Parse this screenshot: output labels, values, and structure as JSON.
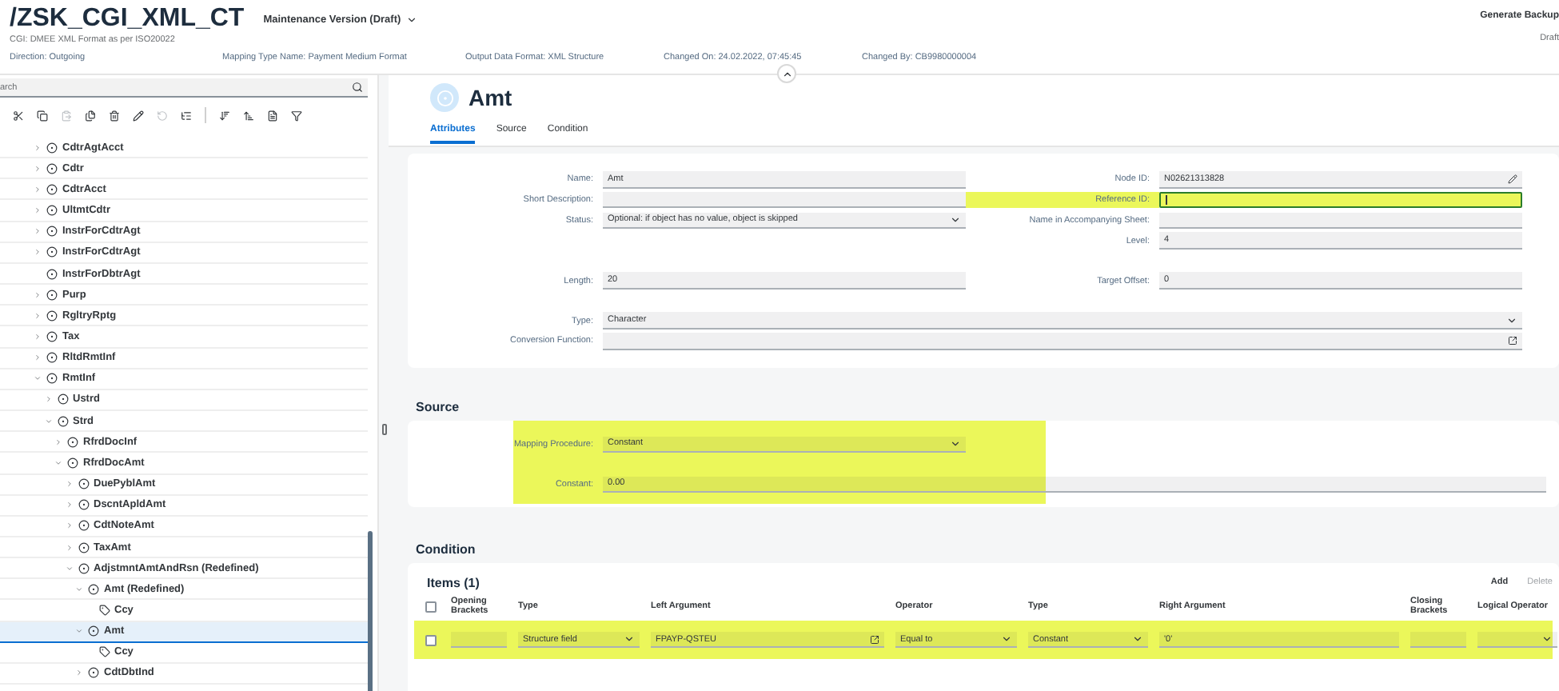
{
  "header": {
    "title": "/ZSK_CGI_XML_CT",
    "version": "Maintenance Version (Draft)",
    "subtitle": "CGI: DMEE XML Format as per ISO20022",
    "info": [
      "Direction: Outgoing",
      "Mapping Type Name: Payment Medium Format",
      "Output Data Format: XML Structure",
      "Changed On: 24.02.2022, 07:45:45",
      "Changed By: CB9980000004"
    ],
    "action": "Generate Backup",
    "status": "Draft"
  },
  "search": {
    "placeholder": "arch"
  },
  "toolbar": [
    {
      "disabled": false
    },
    {
      "disabled": false
    },
    {
      "disabled": true
    },
    {
      "disabled": false
    },
    {
      "disabled": false
    },
    {
      "disabled": false
    },
    {
      "disabled": true
    },
    {
      "disabled": false
    },
    {
      "disabled": false
    },
    {
      "disabled": false
    },
    {
      "disabled": false
    },
    {
      "disabled": false
    }
  ],
  "tree": [
    {
      "label": "CdtrAgtAcct",
      "kind": "element",
      "expanded": false,
      "selected": false
    },
    {
      "label": "Cdtr",
      "kind": "element",
      "expanded": false,
      "selected": false
    },
    {
      "label": "CdtrAcct",
      "kind": "element",
      "expanded": false,
      "selected": false
    },
    {
      "label": "UltmtCdtr",
      "kind": "element",
      "expanded": false,
      "selected": false
    },
    {
      "label": "InstrForCdtrAgt",
      "kind": "element",
      "expanded": false,
      "selected": false
    },
    {
      "label": "InstrForCdtrAgt",
      "kind": "element",
      "expanded": false,
      "selected": false
    },
    {
      "label": "InstrForDbtrAgt",
      "kind": "element",
      "selected": false
    },
    {
      "label": "Purp",
      "kind": "element",
      "expanded": false,
      "selected": false
    },
    {
      "label": "RgltryRptg",
      "kind": "element",
      "expanded": false,
      "selected": false
    },
    {
      "label": "Tax",
      "kind": "element",
      "expanded": false,
      "selected": false
    },
    {
      "label": "RltdRmtInf",
      "kind": "element",
      "expanded": false,
      "selected": false
    },
    {
      "label": "RmtInf",
      "kind": "element",
      "expanded": true,
      "selected": false,
      "children": [
        {
          "label": "Ustrd",
          "kind": "element",
          "expanded": false,
          "selected": false
        },
        {
          "label": "Strd",
          "kind": "element",
          "expanded": true,
          "selected": false,
          "children": [
            {
              "label": "RfrdDocInf",
              "kind": "element",
              "expanded": false,
              "selected": false
            },
            {
              "label": "RfrdDocAmt",
              "kind": "element",
              "expanded": true,
              "selected": false,
              "children": [
                {
                  "label": "DuePyblAmt",
                  "kind": "element",
                  "expanded": false,
                  "selected": false
                },
                {
                  "label": "DscntApldAmt",
                  "kind": "element",
                  "expanded": false,
                  "selected": false
                },
                {
                  "label": "CdtNoteAmt",
                  "kind": "element",
                  "expanded": false,
                  "selected": false
                },
                {
                  "label": "TaxAmt",
                  "kind": "element",
                  "expanded": false,
                  "selected": false
                },
                {
                  "label": "AdjstmntAmtAndRsn (Redefined)",
                  "kind": "element",
                  "expanded": true,
                  "selected": false,
                  "children": [
                    {
                      "label": "Amt (Redefined)",
                      "kind": "element",
                      "expanded": true,
                      "selected": false,
                      "children": [
                        {
                          "label": "Ccy",
                          "kind": "attribute",
                          "selected": false
                        }
                      ]
                    },
                    {
                      "label": "Amt",
                      "kind": "element",
                      "expanded": true,
                      "selected": true,
                      "children": [
                        {
                          "label": "Ccy",
                          "kind": "attribute",
                          "selected": false
                        }
                      ]
                    },
                    {
                      "label": "CdtDbtInd",
                      "kind": "element",
                      "expanded": false,
                      "selected": false
                    }
                  ]
                }
              ]
            }
          ]
        }
      ]
    }
  ],
  "detail": {
    "title": "Amt",
    "tabs": [
      {
        "label": "Attributes",
        "selected": true
      },
      {
        "label": "Source",
        "selected": false
      },
      {
        "label": "Condition",
        "selected": false
      }
    ]
  },
  "attributes": {
    "groups": [
      [
        {
          "left": {
            "label": "Name:",
            "value": "Amt",
            "kind": "text"
          },
          "right": {
            "label": "Node ID:",
            "value": "N02621313828",
            "kind": "edit"
          }
        },
        {
          "left": {
            "label": "Short Description:",
            "kind": "text"
          },
          "right": {
            "label": "Reference ID:",
            "kind": "text",
            "highlighted": true,
            "focused": true
          }
        },
        {
          "left": {
            "label": "Status:",
            "value": "Optional: if object has no value, object is skipped",
            "kind": "select"
          },
          "right": {
            "label": "Name in Accompanying Sheet:",
            "kind": "text"
          }
        },
        {
          "right": {
            "label": "Level:",
            "value": "4",
            "kind": "text"
          }
        }
      ],
      [
        {
          "left": {
            "label": "Length:",
            "value": "20",
            "kind": "text"
          },
          "right": {
            "label": "Target Offset:",
            "value": "0",
            "kind": "text"
          }
        }
      ],
      [
        {
          "full": {
            "label": "Type:",
            "value": "Character",
            "kind": "select"
          }
        },
        {
          "full": {
            "label": "Conversion Function:",
            "kind": "value-help"
          }
        }
      ]
    ]
  },
  "source": {
    "title": "Source",
    "highlighted": true,
    "fields": [
      {
        "label": "Mapping Procedure:",
        "value": "Constant",
        "kind": "select"
      },
      {
        "label": "Constant:",
        "value": "0.00",
        "kind": "text"
      }
    ]
  },
  "condition": {
    "title": "Condition",
    "items_title": "Items (1)",
    "select_all": false,
    "actions": [
      {
        "label": "Add",
        "disabled": false
      },
      {
        "label": "Delete",
        "disabled": true
      }
    ],
    "columns": [
      "Opening Brackets",
      "Type",
      "Left Argument",
      "Operator",
      "Type",
      "Right Argument",
      "Closing Brackets",
      "Logical Operator"
    ],
    "rows": [
      {
        "selected": false,
        "highlighted": true,
        "cells": [
          {
            "kind": "text"
          },
          {
            "kind": "select",
            "value": "Structure field"
          },
          {
            "kind": "value-help",
            "value": "FPAYP-QSTEU"
          },
          {
            "kind": "select",
            "value": "Equal to"
          },
          {
            "kind": "select",
            "value": "Constant"
          },
          {
            "kind": "text",
            "value": "'0'"
          },
          {
            "kind": "text"
          },
          {
            "kind": "select"
          }
        ]
      }
    ]
  }
}
